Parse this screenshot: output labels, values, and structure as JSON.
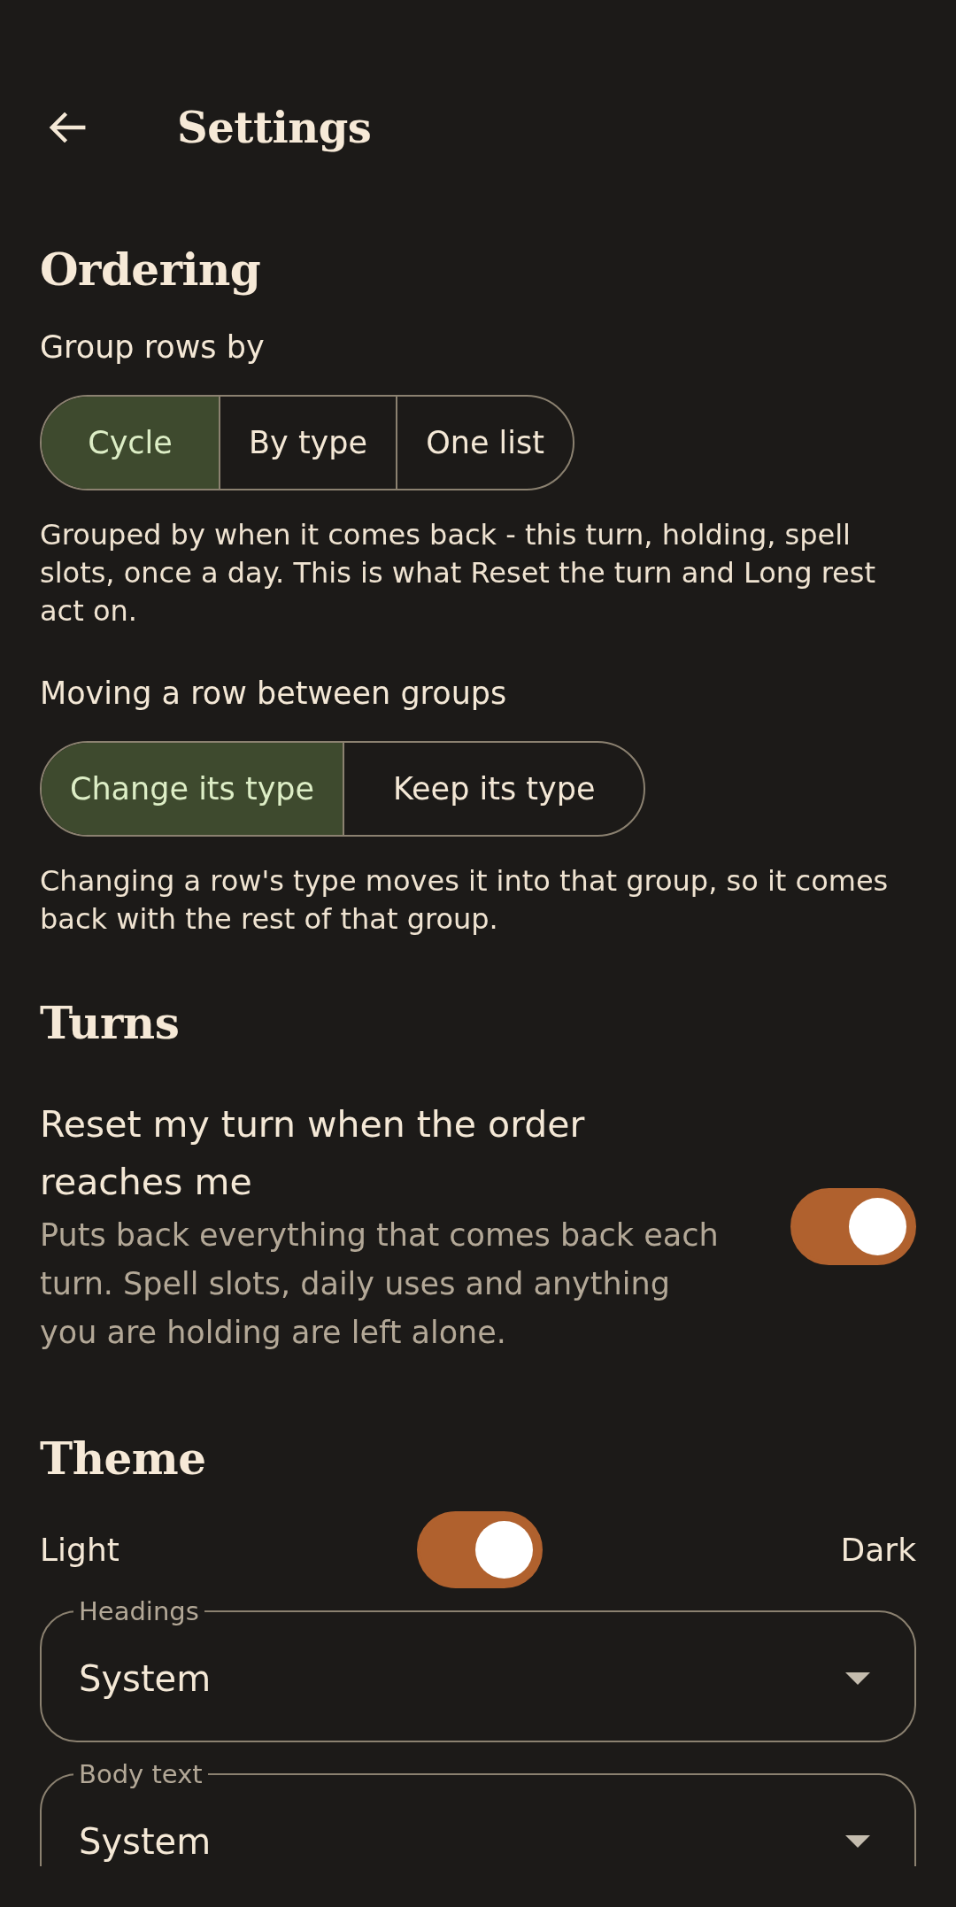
{
  "app_bar": {
    "title": "Settings"
  },
  "sections": [
    {
      "heading": "Ordering",
      "items": [
        {
          "kind": "segmented",
          "label": "Group rows by",
          "options": [
            {
              "label": "Cycle",
              "selected": true
            },
            {
              "label": "By type",
              "selected": false
            },
            {
              "label": "One list",
              "selected": false
            }
          ],
          "help": "Grouped by when it comes back - this turn, holding, spell slots, once a day. This is what Reset the turn and Long rest act on."
        },
        {
          "kind": "segmented",
          "label": "Moving a row between groups",
          "options": [
            {
              "label": "Change its type",
              "selected": true
            },
            {
              "label": "Keep its type",
              "selected": false
            }
          ],
          "help": "Changing a row's type moves it into that group, so it comes back with the rest of that group."
        }
      ]
    },
    {
      "heading": "Turns",
      "items": [
        {
          "kind": "switch",
          "label": "Reset my turn when the order reaches me",
          "description": "Puts back everything that comes back each turn. Spell slots, daily uses and anything you are holding are left alone.",
          "on": true
        }
      ]
    },
    {
      "heading": "Theme",
      "items": [
        {
          "kind": "theme_switch",
          "left_label": "Light",
          "right_label": "Dark",
          "on": true
        },
        {
          "kind": "dropdown",
          "label": "Headings",
          "value": "System"
        },
        {
          "kind": "dropdown",
          "label": "Body text",
          "value": "System"
        }
      ]
    }
  ]
}
